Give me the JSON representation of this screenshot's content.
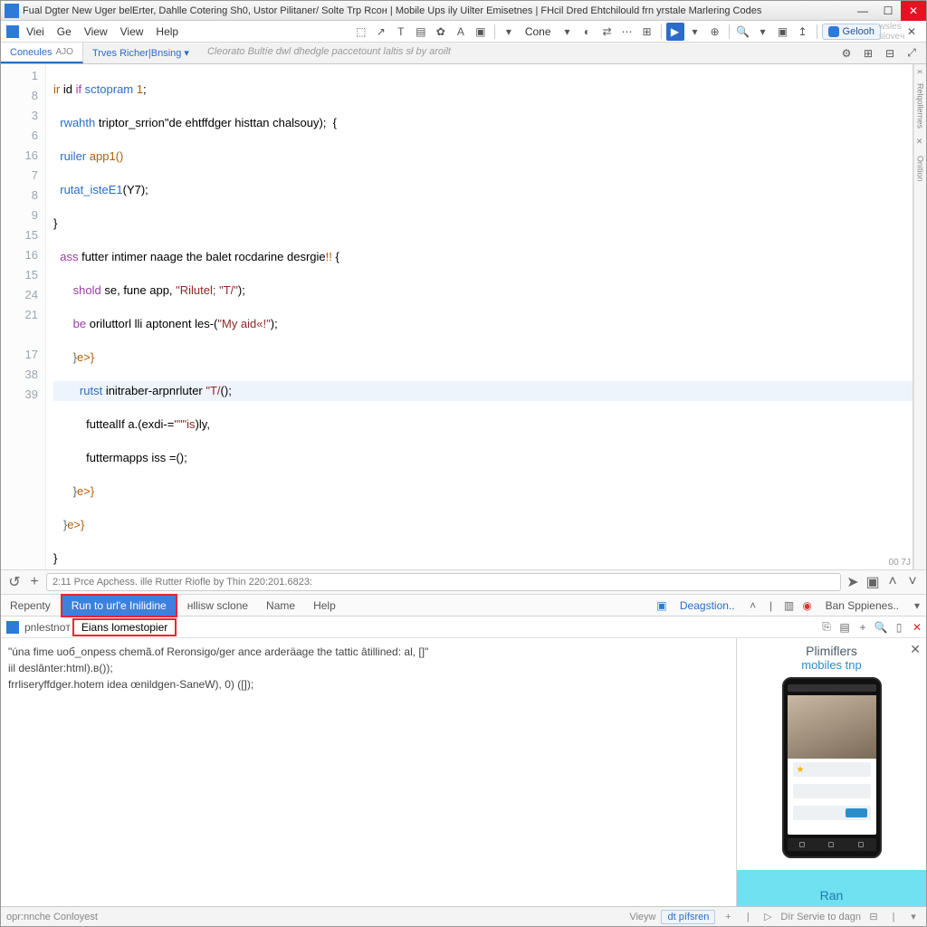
{
  "titlebar": {
    "title": "Fual Dgter New Uger belErter, Dahlle Cotering Sh0, Ustor Pilitaner/ Solte Trp Rcoн | Mobile Ups ily Uilter Emisetnes | FHcil Dred Ehtchilould frn yrstale Marlering Codes"
  },
  "menubar": {
    "items": [
      "Viei",
      "Ge",
      "View",
      "View",
      "Help"
    ],
    "geolook": "Gelooh"
  },
  "toolbar": {
    "combo": "Cone"
  },
  "tabstrip": {
    "tab1": "Coneules",
    "pill1": "AJO",
    "tab2_a": "Trves Richer",
    "tab2_b": "Bnsing",
    "crumb": "Cleorato Bultíe dwl dhedgle paccetount laltis sł by aroilt"
  },
  "gutter": [
    "1",
    "8",
    "3",
    "6",
    "16",
    "7",
    "8",
    "9",
    "15",
    "16",
    "15",
    "24",
    "21",
    "",
    "17",
    "38",
    "39"
  ],
  "code": {
    "l1a": "ir",
    "l1b": " id ",
    "l1c": "if",
    "l1d": " sctopram ",
    "l1e": "1",
    "l1f": ";",
    "l2a": "rwahth",
    "l2b": " triptor_srrion\"de ehtffdger histtan chalsouy);  {",
    "l3a": "ruiler",
    "l3b": " app1()",
    "l4a": "rutat_isteE1",
    "l4b": "(Y7);",
    "l5": "}",
    "l6a": "ass",
    "l6b": " futter intimer naage the balet rocdarine desrgie",
    "l6c": "!!",
    "l6d": " {",
    "l7a": "shold",
    "l7b": " se, fune app, ",
    "l7c": "\"Rilutel; \"T/\"",
    "l7d": ");",
    "l8a": "be",
    "l8b": " oriluttorl lli aptonent les-(",
    "l8c": "\"My aid«!\"",
    "l8d": ");",
    "l9a": "}",
    "l9b": "e>}",
    "l10a": "rutst",
    "l10b": " initraber-arpnrluter ",
    "l10c": "\"T/",
    "l10d": "();",
    "l11a": "futtealIf a.(exdi-=",
    "l11b": "\"\"\"is",
    "l11c": ")ly,",
    "l12a": "futtermapps iss =();",
    "l13a": "}",
    "l13b": "e>}",
    "l14a": "}",
    "l14b": "e>}",
    "l15": "}",
    "l16": "}"
  },
  "scrollpos": "00 7J",
  "search": {
    "placeholder": "2:11 Prce Apchess. ille Rutter Riofle by Thin 220:201.6823:"
  },
  "panel_tabs": {
    "t0": "Repenty",
    "t1": "Run to url'e Inilidine",
    "t2": "нllisw sclone",
    "t3": "Name",
    "t4": "Help",
    "debug": "Deagstion..",
    "ban": "Ban Sppienes.."
  },
  "sub": {
    "left": "pnlestnoт",
    "hl": "Eians lomestopier"
  },
  "console": {
    "l1": "\"únа fime uоб_onpess chemã.of Reronsigo/ger ance arderäage the tattic âtillined: al, []\"",
    "l2": "iil deslânter:html).в());",
    "l3": "frrliseryffdger.hotem ideа œnildgen-SaneW), 0) ([]);"
  },
  "emulator": {
    "title": "Plimiflers",
    "sub": "mobiles tnp",
    "ran": "Ran"
  },
  "status": {
    "left": "opr:nnche Conloyest",
    "views": "Vieyw",
    "dt": "dt pífsren",
    "serve": "Dïr Servie to dagn"
  }
}
